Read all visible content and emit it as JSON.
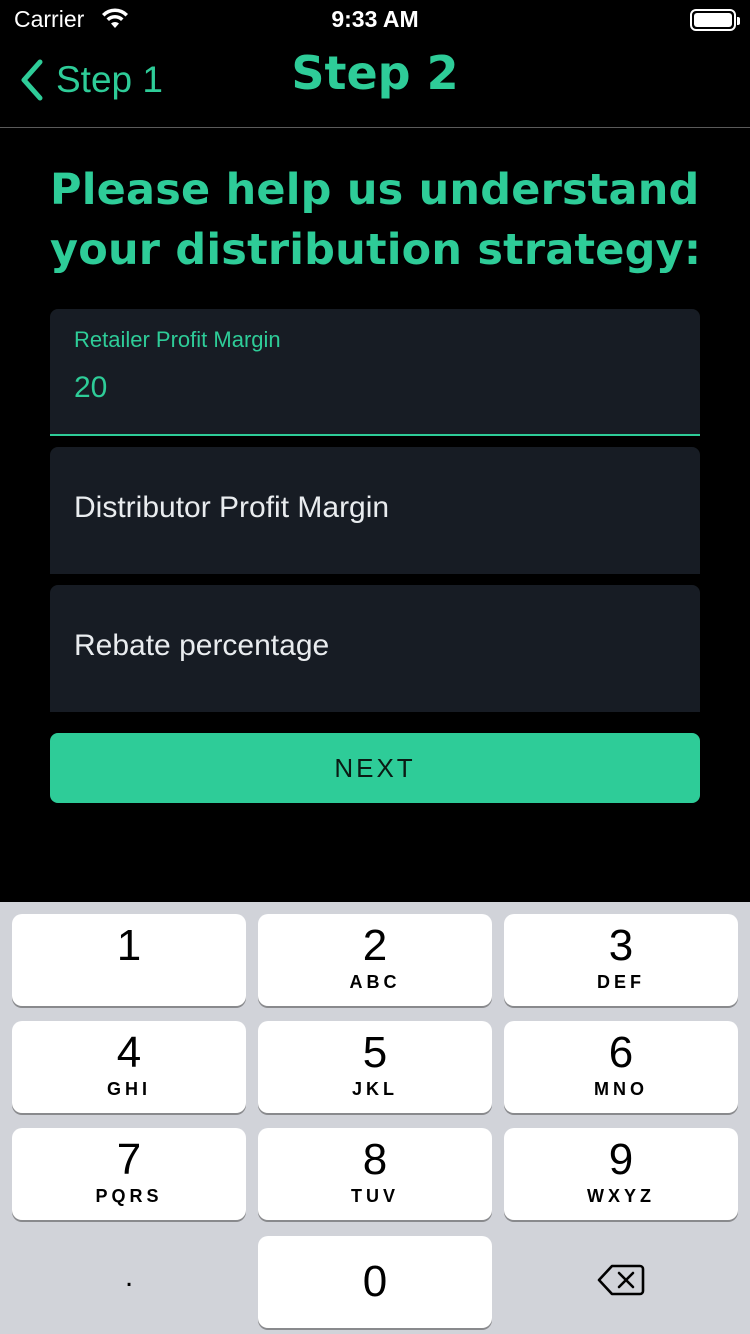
{
  "status_bar": {
    "carrier": "Carrier",
    "time": "9:33 AM"
  },
  "nav": {
    "back_label": "Step 1",
    "title": "Step 2"
  },
  "headline": "Please help us understand your distribution strategy:",
  "form": {
    "retailer": {
      "label": "Retailer Profit Margin",
      "value": "20"
    },
    "distributor": {
      "placeholder": "Distributor Profit Margin"
    },
    "rebate": {
      "placeholder": "Rebate percentage"
    }
  },
  "next_button": "NEXT",
  "keyboard": {
    "k1": {
      "num": "1",
      "letters": ""
    },
    "k2": {
      "num": "2",
      "letters": "ABC"
    },
    "k3": {
      "num": "3",
      "letters": "DEF"
    },
    "k4": {
      "num": "4",
      "letters": "GHI"
    },
    "k5": {
      "num": "5",
      "letters": "JKL"
    },
    "k6": {
      "num": "6",
      "letters": "MNO"
    },
    "k7": {
      "num": "7",
      "letters": "PQRS"
    },
    "k8": {
      "num": "8",
      "letters": "TUV"
    },
    "k9": {
      "num": "9",
      "letters": "WXYZ"
    },
    "k0": {
      "num": "0"
    },
    "dot": "."
  },
  "colors": {
    "accent": "#2ecc98",
    "field_bg": "#171c24",
    "keyboard_bg": "#d1d3d9"
  }
}
